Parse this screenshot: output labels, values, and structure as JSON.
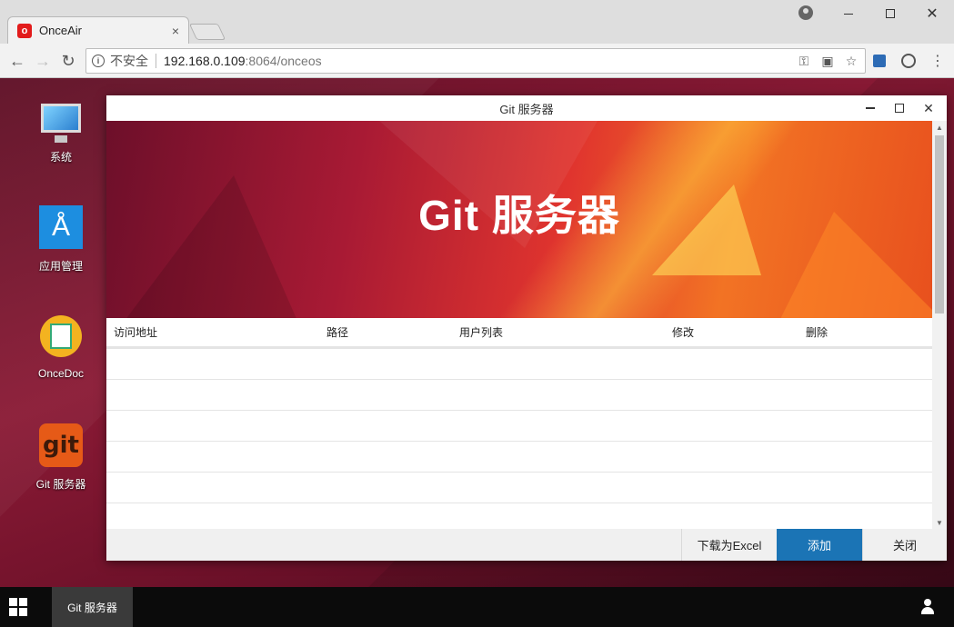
{
  "browser": {
    "tab_title": "OnceAir",
    "tab_favicon_letter": "o",
    "tab_close": "×",
    "address": {
      "insecure_label": "不安全",
      "host": "192.168.0.109",
      "rest": ":8064/onceos"
    },
    "icons": [
      "info-icon",
      "key-icon",
      "translate-icon",
      "star-icon",
      "extension-icon",
      "extension-icon",
      "menu-icon"
    ]
  },
  "desktop": {
    "icons": [
      {
        "label": "系统",
        "icon": "monitor-icon"
      },
      {
        "label": "应用管理",
        "icon": "app-store-icon"
      },
      {
        "label": "OnceDoc",
        "icon": "document-icon"
      },
      {
        "label": "Git 服务器",
        "icon": "git-icon",
        "glyph": "git"
      }
    ]
  },
  "window": {
    "title": "Git 服务器",
    "banner_title": "Git 服务器",
    "table": {
      "columns": [
        "访问地址",
        "路径",
        "用户列表",
        "修改",
        "删除"
      ],
      "rows": [
        [],
        [],
        [],
        [],
        [],
        []
      ]
    },
    "footer": {
      "excel_label": "下载为Excel",
      "add_label": "添加",
      "close_label": "关闭"
    }
  },
  "taskbar": {
    "active_item": "Git 服务器"
  },
  "colors": {
    "primary_button": "#1b74b5",
    "desktop_bg": "#7a1530"
  }
}
